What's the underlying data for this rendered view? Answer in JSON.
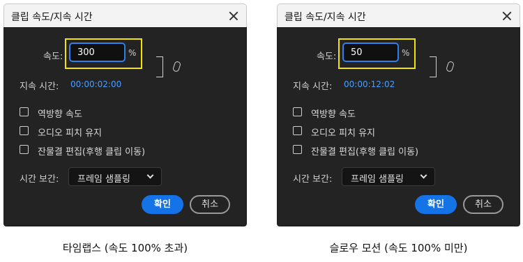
{
  "dialogs": [
    {
      "title": "클립 속도/지속 시간",
      "speed_label": "속도:",
      "speed_value": "300",
      "percent_symbol": "%",
      "duration_label": "지속 시간:",
      "duration_value": "00:00:02:00",
      "checkboxes": [
        {
          "label": "역방향 속도",
          "checked": false
        },
        {
          "label": "오디오 피치 유지",
          "checked": false
        },
        {
          "label": "잔물결 편집(후행 클립 이동)",
          "checked": false
        }
      ],
      "interpolation_label": "시간 보간:",
      "interpolation_value": "프레임 샘플링",
      "ok_label": "확인",
      "cancel_label": "취소"
    },
    {
      "title": "클립 속도/지속 시간",
      "speed_label": "속도:",
      "speed_value": "50",
      "percent_symbol": "%",
      "duration_label": "지속 시간:",
      "duration_value": "00:00:12:02",
      "checkboxes": [
        {
          "label": "역방향 속도",
          "checked": false
        },
        {
          "label": "오디오 피치 유지",
          "checked": false
        },
        {
          "label": "잔물결 편집(후행 클립 이동)",
          "checked": false
        }
      ],
      "interpolation_label": "시간 보간:",
      "interpolation_value": "프레임 샘플링",
      "ok_label": "확인",
      "cancel_label": "취소"
    }
  ],
  "captions": [
    "타임랩스 (속도 100% 초과)",
    "슬로우 모션 (속도 100% 미만)"
  ],
  "colors": {
    "dialog_bg": "#232323",
    "titlebar_bg": "#f3f3f3",
    "accent_blue": "#1473e6",
    "input_focus": "#2f80ed",
    "duration_text": "#4a9eff",
    "highlight_yellow": "#f2e40a"
  },
  "icons": {
    "close": "close-icon",
    "link": "chain-link-icon",
    "dropdown": "chevron-down-icon"
  }
}
